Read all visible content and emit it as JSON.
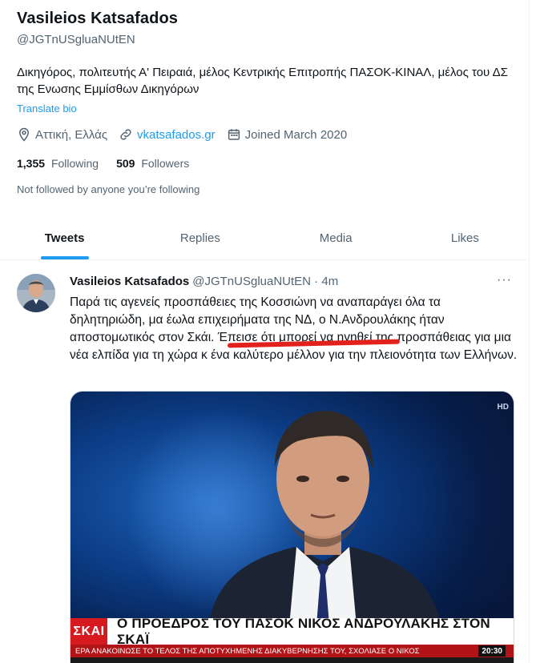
{
  "profile": {
    "name": "Vasileios Katsafados",
    "handle": "@JGTnUSgluaNUtEN",
    "bio": "Δικηγόρος, πολιτευτής Α' Πειραιά, μέλος Κεντρικής Επιτροπής ΠΑΣΟΚ-ΚΙΝΑΛ, μέλος του ΔΣ της Ενωσης Εμμίσθων Δικηγόρων",
    "translate_bio": "Translate bio",
    "location": "Αττική, Ελλάς",
    "website": "vkatsafados.gr",
    "joined": "Joined March 2020",
    "following_count": "1,355",
    "following_label": "Following",
    "followers_count": "509",
    "followers_label": "Followers",
    "not_followed": "Not followed by anyone you’re following"
  },
  "tabs": [
    {
      "label": "Tweets",
      "active": true
    },
    {
      "label": "Replies",
      "active": false
    },
    {
      "label": "Media",
      "active": false
    },
    {
      "label": "Likes",
      "active": false
    }
  ],
  "tweet": {
    "author_name": "Vasileios Katsafados",
    "author_handle": "@JGTnUSgluaNUtEN · 4m",
    "more": "···",
    "text": "Παρά τις αγενείς προσπάθειες της Κοσσιώνη να αναπαράγει όλα τα δηλητηριώδη, μα έωλα επιχειρήματα της ΝΔ, ο Ν.Ανδρουλάκης ήταν αποστομωτικός στον Σκάι. Έπεισε ότι μπορεί να ηγηθεί της προσπάθειας για μια νέα ελπίδα για τη χώρα κ ένα καλύτερο μέλλον για την πλειονότητα των Ελλήνων.",
    "media": {
      "channel_logo": "ΣΚΑΙ",
      "headline": "Ο ΠΡΟΕΔΡΟΣ ΤΟΥ ΠΑΣΟΚ ΝΙΚΟΣ ΑΝΔΡΟΥΛΑΚΗΣ ΣΤΟΝ ΣΚΑΪ",
      "ticker": "ΕΡΑ ΑΝΑΚΟΙΝΩΣΕ ΤΟ ΤΕΛΟΣ ΤΗΣ ΑΠΟΤΥΧΗΜΕΝΗΣ ΔΙΑΚΥΒΕΡΝΗΣΗΣ ΤΟΥ, ΣΧΟΛΙΑΣΕ Ο ΝΙΚΟΣ",
      "clock": "20:30",
      "hd_tag": "HD"
    }
  },
  "colors": {
    "accent": "#1d9bf0",
    "text_primary": "#0f1419",
    "text_secondary": "#536471",
    "annotation_red": "#e2211c"
  }
}
